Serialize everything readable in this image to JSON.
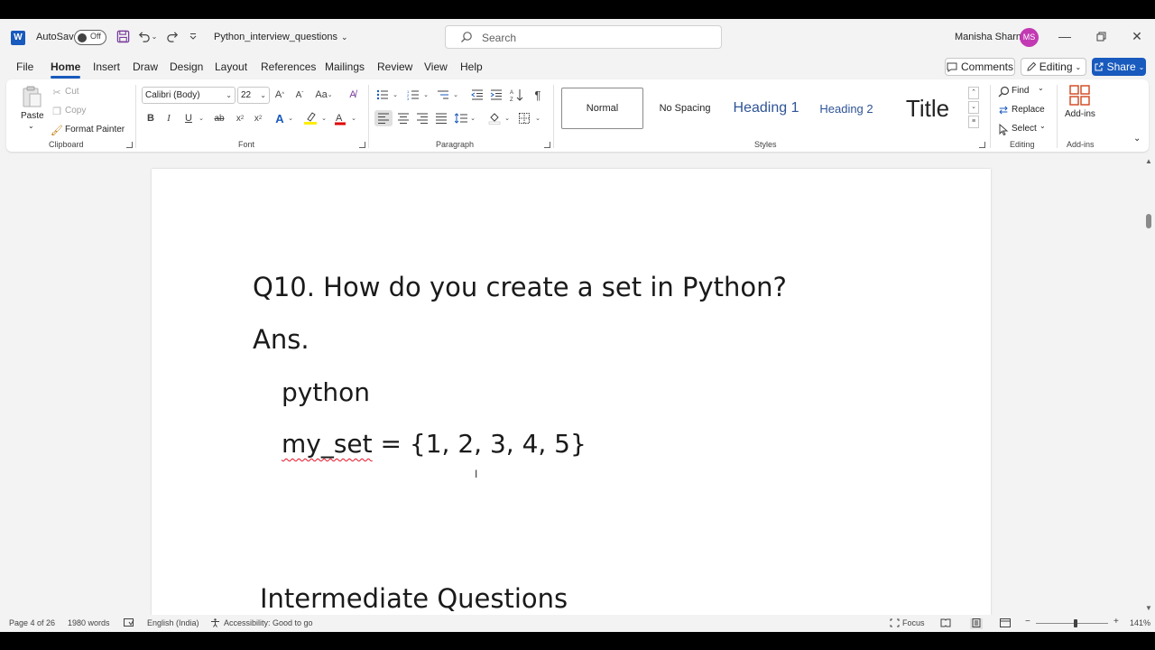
{
  "titlebar": {
    "autosave_label": "AutoSave",
    "autosave_state": "Off",
    "doc_title": "Python_interview_questions",
    "search_placeholder": "Search",
    "user_name": "Manisha Sharma",
    "user_initials": "MS"
  },
  "menu": {
    "tabs": [
      "File",
      "Home",
      "Insert",
      "Draw",
      "Design",
      "Layout",
      "References",
      "Mailings",
      "Review",
      "View",
      "Help"
    ],
    "active": "Home",
    "comments_label": "Comments",
    "editing_label": "Editing",
    "share_label": "Share"
  },
  "ribbon": {
    "clipboard": {
      "label": "Clipboard",
      "paste": "Paste",
      "cut": "Cut",
      "copy": "Copy",
      "format_painter": "Format Painter"
    },
    "font": {
      "label": "Font",
      "family": "Calibri (Body)",
      "size": "22"
    },
    "paragraph": {
      "label": "Paragraph"
    },
    "styles": {
      "label": "Styles",
      "items": [
        "Normal",
        "No Spacing",
        "Heading 1",
        "Heading 2",
        "Title"
      ],
      "selected": "Normal"
    },
    "editing": {
      "label": "Editing",
      "find": "Find",
      "replace": "Replace",
      "select": "Select"
    },
    "addins": {
      "label": "Add-ins",
      "button": "Add-ins"
    }
  },
  "document": {
    "question": "Q10. How do you create a set in Python?",
    "answer_label": "Ans.",
    "code_lang": "python",
    "code_var": "my_set",
    "code_rest": " = {1, 2, 3, 4, 5}",
    "section_heading": "Intermediate Questions"
  },
  "status": {
    "page": "Page 4 of 26",
    "words": "1980 words",
    "language": "English (India)",
    "accessibility": "Accessibility: Good to go",
    "focus": "Focus",
    "zoom": "141%"
  },
  "colors": {
    "accent": "#185abd",
    "avatar": "#c239b3",
    "spell_error": "#e81123"
  }
}
